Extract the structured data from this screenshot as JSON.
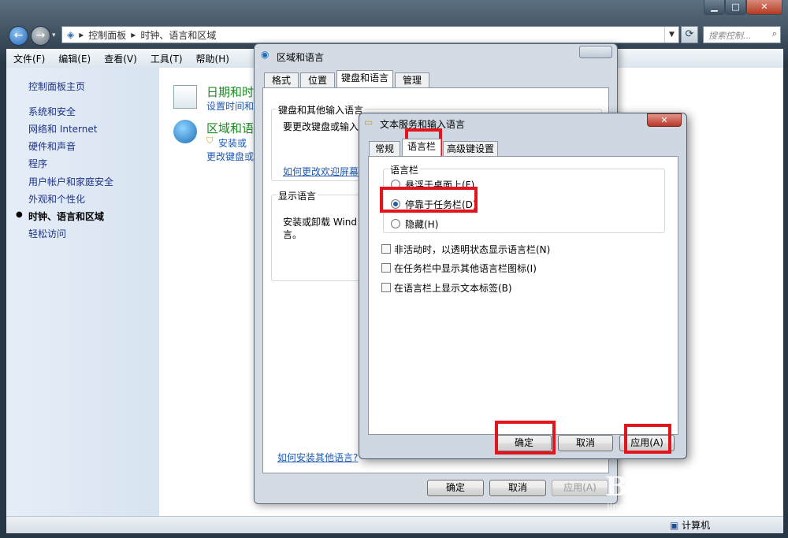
{
  "explorer": {
    "breadcrumb": [
      "控制面板",
      "时钟、语言和区域"
    ],
    "search_placeholder": "搜索控制...",
    "menu": [
      "文件(F)",
      "编辑(E)",
      "查看(V)",
      "工具(T)",
      "帮助(H)"
    ],
    "nav": {
      "home": "控制面板主页",
      "items": [
        "系统和安全",
        "网络和 Internet",
        "硬件和声音",
        "程序",
        "用户帐户和家庭安全",
        "外观和个性化",
        "时钟、语言和区域",
        "轻松访问"
      ]
    },
    "categories": [
      {
        "title": "日期和时",
        "link": "设置时间和"
      },
      {
        "title": "区域和语",
        "link1": "安装或",
        "link2": "更改键盘或"
      }
    ],
    "status_computer": "计算机"
  },
  "region_dialog": {
    "title": "区域和语言",
    "tabs": [
      "格式",
      "位置",
      "键盘和语言",
      "管理"
    ],
    "kb_group": "键盘和其他输入语言",
    "kb_text": "要更改键盘或输入",
    "kb_link": "如何更改欢迎屏幕",
    "display_group": "显示语言",
    "display_text_1": "安装或卸载 Wind",
    "display_text_2": "言。",
    "install_link": "如何安装其他语言?",
    "buttons": {
      "ok": "确定",
      "cancel": "取消",
      "apply": "应用(A)"
    }
  },
  "text_services": {
    "title": "文本服务和输入语言",
    "tabs": [
      "常规",
      "语言栏",
      "高级键设置"
    ],
    "group": "语言栏",
    "radios": [
      "悬浮于桌面上(F)",
      "停靠于任务栏(D)",
      "隐藏(H)"
    ],
    "selected_radio": 1,
    "checks": [
      "非活动时，以透明状态显示语言栏(N)",
      "在任务栏中显示其他语言栏图标(I)",
      "在语言栏上显示文本标签(B)"
    ],
    "buttons": {
      "ok": "确定",
      "cancel": "取消",
      "apply": "应用(A)"
    }
  },
  "watermark": {
    "brand": "Bai du 经验",
    "url": "jingyan.baidu.com"
  }
}
